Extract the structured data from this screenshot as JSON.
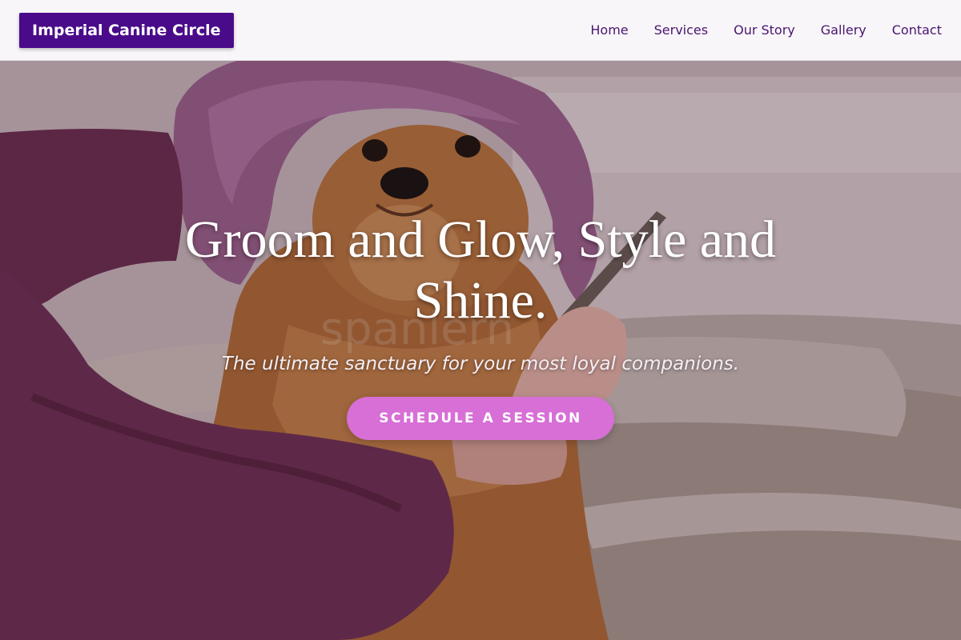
{
  "header": {
    "brand": "Imperial Canine Circle",
    "nav": [
      "Home",
      "Services",
      "Our Story",
      "Gallery",
      "Contact"
    ]
  },
  "hero": {
    "headline": "Groom and Glow, Style and Shine.",
    "tagline": "The ultimate sanctuary for your most loyal companions.",
    "cta_label": "SCHEDULE A SESSION",
    "image_watermark": "spanlern"
  },
  "colors": {
    "brand_bg": "#4a0b8a",
    "nav_text": "#4a1470",
    "cta_bg": "#d76fd6",
    "header_bg": "#f8f6f9"
  }
}
